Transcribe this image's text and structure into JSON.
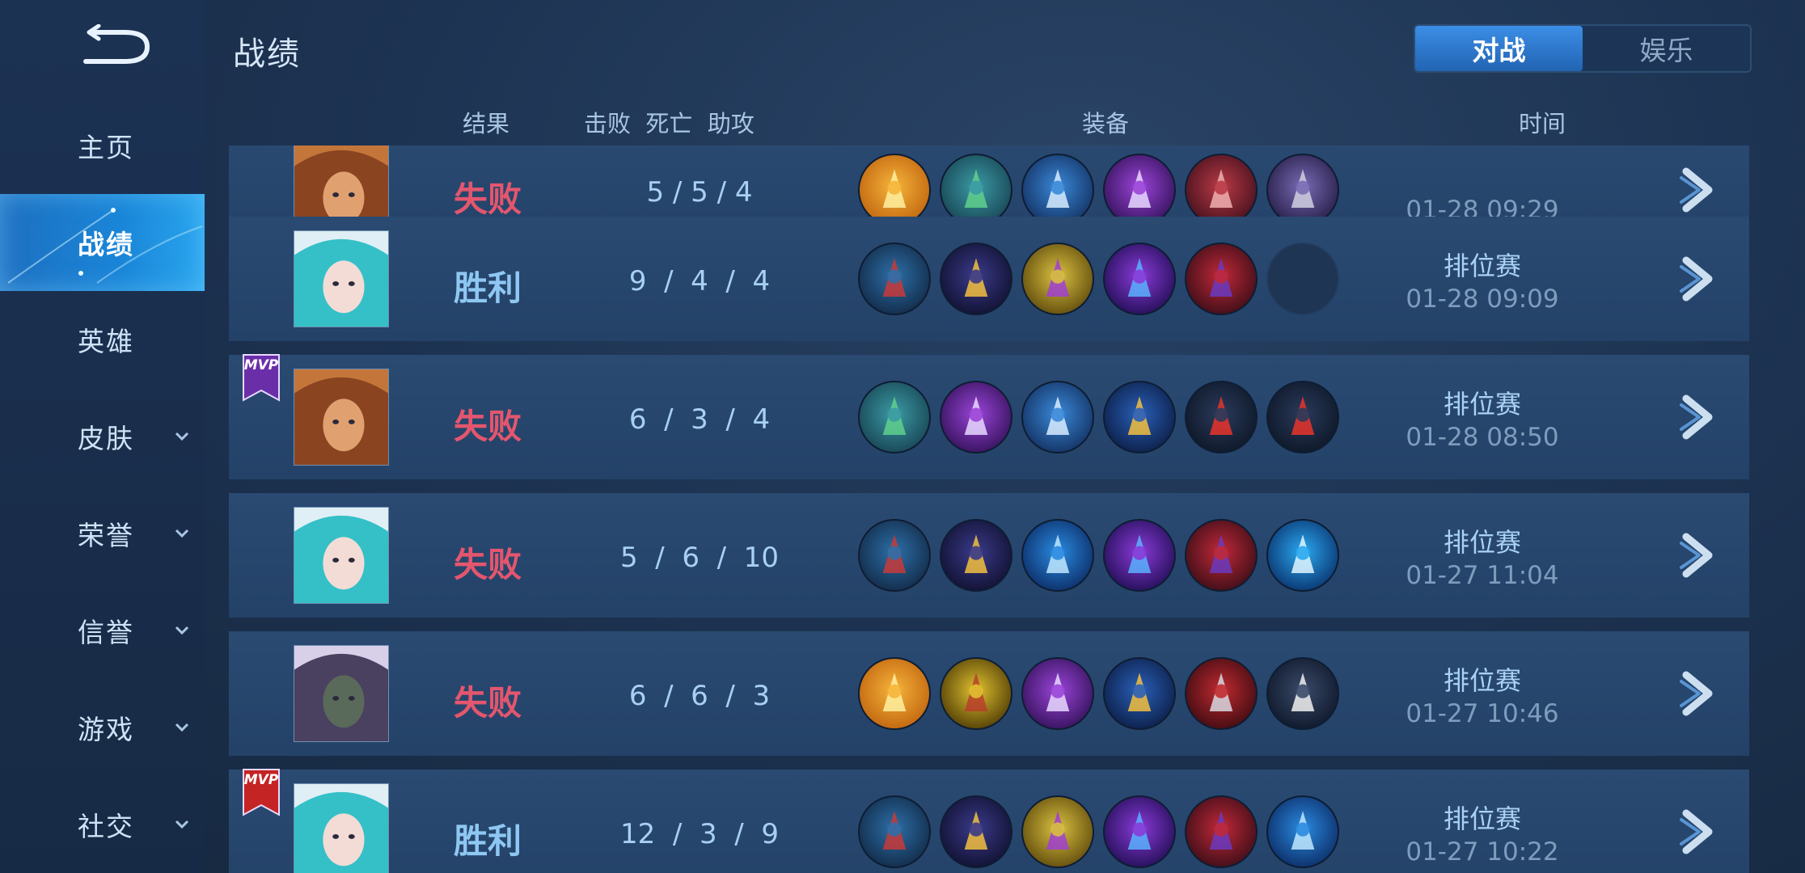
{
  "header": {
    "title": "战绩"
  },
  "tabs": [
    {
      "label": "对战",
      "active": true
    },
    {
      "label": "娱乐",
      "active": false
    }
  ],
  "sidebar": {
    "items": [
      {
        "label": "主页",
        "active": false,
        "expandable": false
      },
      {
        "label": "战绩",
        "active": true,
        "expandable": false
      },
      {
        "label": "英雄",
        "active": false,
        "expandable": false
      },
      {
        "label": "皮肤",
        "active": false,
        "expandable": true
      },
      {
        "label": "荣誉",
        "active": false,
        "expandable": true
      },
      {
        "label": "信誉",
        "active": false,
        "expandable": true
      },
      {
        "label": "游戏",
        "active": false,
        "expandable": true
      },
      {
        "label": "社交",
        "active": false,
        "expandable": true
      }
    ]
  },
  "columns": {
    "result": "结果",
    "kda": "击败  死亡  助攻",
    "equipment": "装备",
    "time": "时间"
  },
  "colors": {
    "win": "#8ec8f2",
    "lose": "#e4566e",
    "accent": "#2a86e0"
  },
  "matches": [
    {
      "result": "失败",
      "outcome": "lose",
      "kda": "5 / 5 / 4",
      "mode": "",
      "time": "01-28  09:29",
      "mvp": "",
      "hero": "hero-b",
      "items": [
        "fire-blade",
        "boots-green",
        "crystal-spear",
        "purple-axe",
        "red-armor",
        "grey-shield"
      ]
    },
    {
      "result": "胜利",
      "outcome": "win",
      "kda": "9  /  4  /  4",
      "mode": "排位赛",
      "time": "01-28  09:09",
      "mvp": "",
      "hero": "hero-a",
      "items": [
        "boots-red",
        "golden-chalice",
        "golden-scepter",
        "dragon-staff",
        "mage-hat",
        "empty"
      ]
    },
    {
      "result": "失败",
      "outcome": "lose",
      "kda": "6  /  3  /  4",
      "mode": "排位赛",
      "time": "01-28  08:50",
      "mvp": "MVP",
      "mvp_color": "#6a2fa8",
      "hero": "hero-b",
      "items": [
        "boots-green",
        "purple-axe",
        "crystal-spear",
        "trident",
        "red-gem",
        "red-gem"
      ]
    },
    {
      "result": "失败",
      "outcome": "lose",
      "kda": "5  /  6  /  10",
      "mode": "排位赛",
      "time": "01-27  11:04",
      "mvp": "",
      "hero": "hero-a",
      "items": [
        "boots-red",
        "golden-chalice",
        "ice-wand",
        "dragon-staff",
        "mage-hat",
        "blue-orb"
      ]
    },
    {
      "result": "失败",
      "outcome": "lose",
      "kda": "6  /  6  /  3",
      "mode": "排位赛",
      "time": "01-27  10:46",
      "mvp": "",
      "hero": "hero-c",
      "items": [
        "fire-blade",
        "golden-boots",
        "purple-axe",
        "trident",
        "red-gauntlet",
        "white-armor"
      ]
    },
    {
      "result": "胜利",
      "outcome": "win",
      "kda": "12  /  3  /  9",
      "mode": "排位赛",
      "time": "01-27  10:22",
      "mvp": "MVP",
      "mvp_color": "#c42424",
      "hero": "hero-a",
      "items": [
        "boots-red",
        "golden-chalice",
        "golden-scepter",
        "dragon-staff",
        "mage-hat",
        "ice-wand"
      ]
    }
  ]
}
